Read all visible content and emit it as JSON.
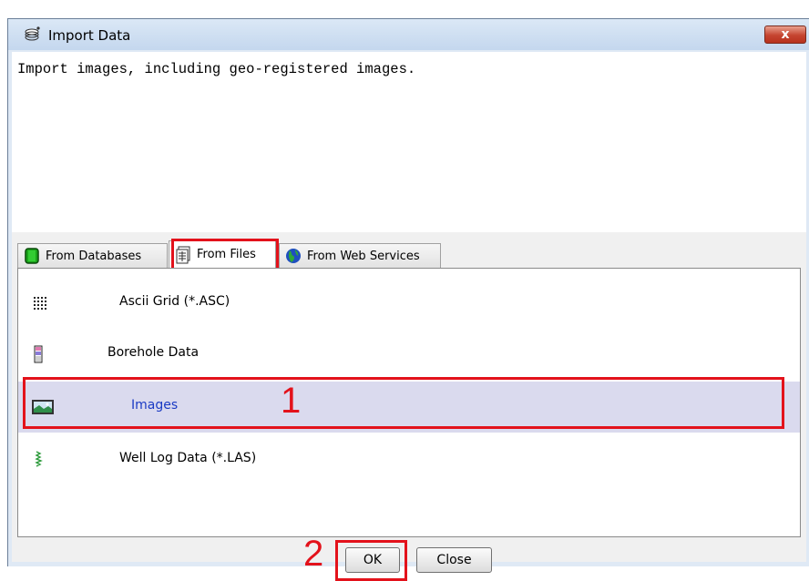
{
  "window": {
    "title": "Import Data",
    "close_label": "x"
  },
  "description": "Import images, including geo-registered images.",
  "tabs": [
    {
      "label": "From Databases",
      "icon": "database-icon",
      "active": false
    },
    {
      "label": "From Files",
      "icon": "files-icon",
      "active": true
    },
    {
      "label": "From Web Services",
      "icon": "globe-icon",
      "active": false
    }
  ],
  "items": [
    {
      "label": "Ascii Grid (*.ASC)",
      "icon": "grid-dots-icon",
      "selected": false
    },
    {
      "label": "Borehole Data",
      "icon": "borehole-icon",
      "selected": false
    },
    {
      "label": "Images",
      "icon": "image-icon",
      "selected": true
    },
    {
      "label": "Well Log Data (*.LAS)",
      "icon": "well-log-icon",
      "selected": false
    }
  ],
  "buttons": {
    "ok": "OK",
    "close": "Close"
  },
  "annotations": {
    "step1": "1",
    "step2": "2"
  },
  "colors": {
    "annotation": "#e3121b",
    "selection": "#dadaee",
    "selected_text": "#1a3ac4",
    "window_bg": "#dfe9f5"
  }
}
